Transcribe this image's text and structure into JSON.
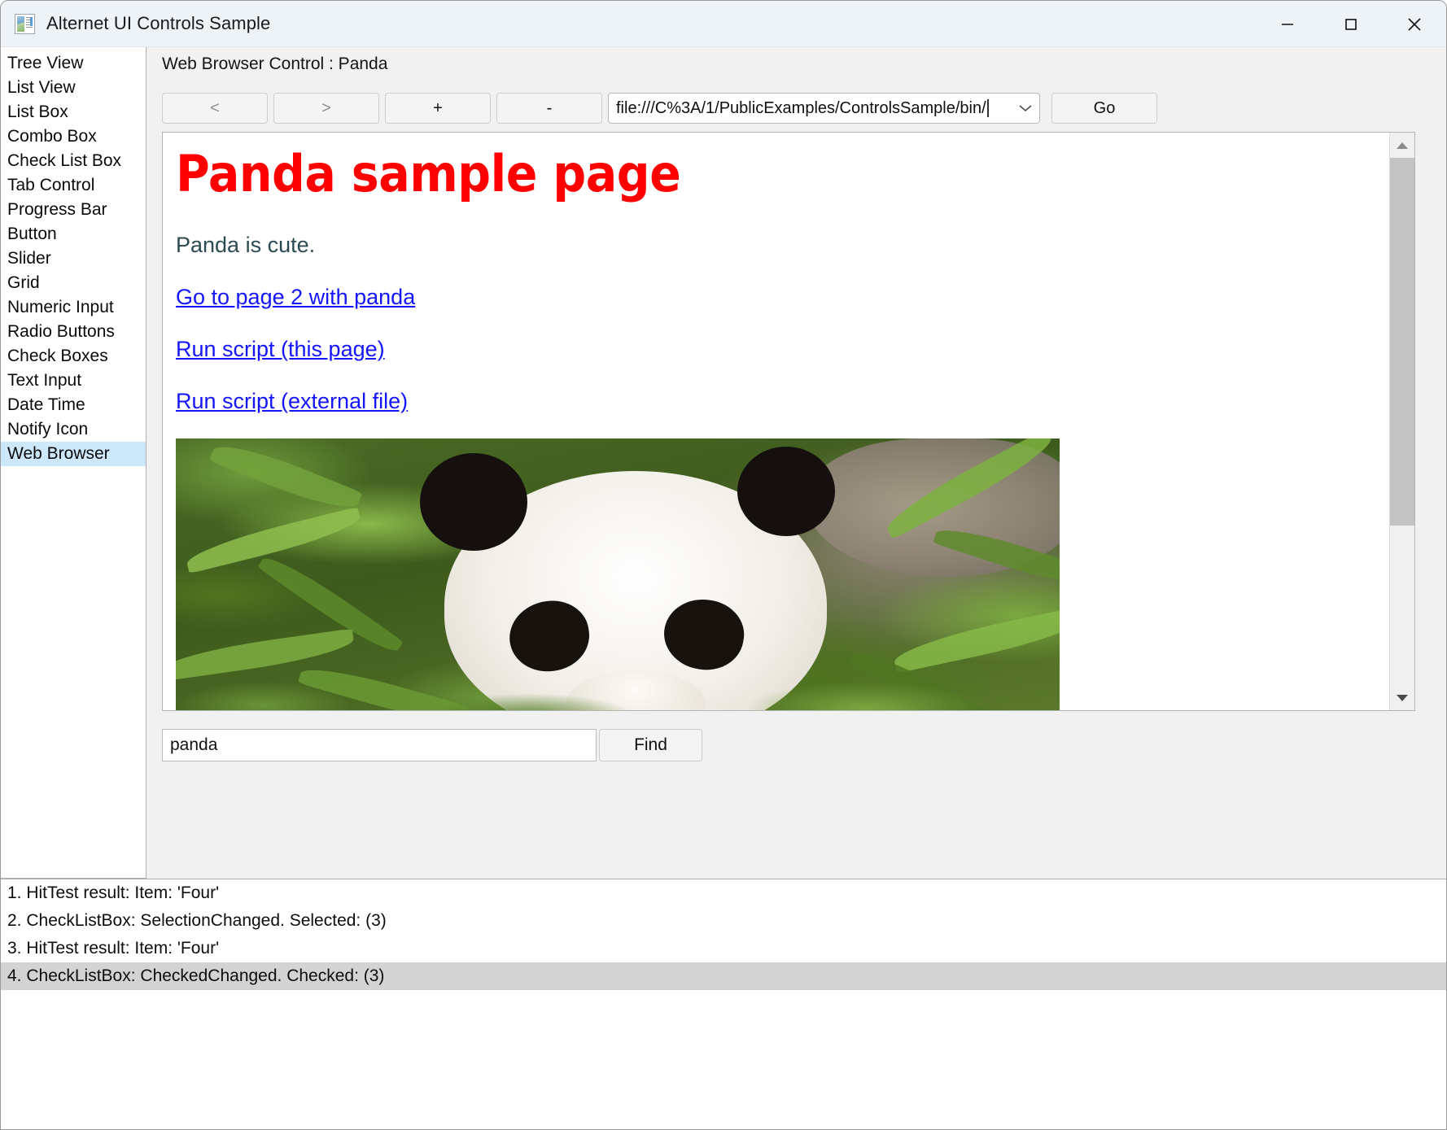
{
  "window": {
    "title": "Alternet UI Controls Sample",
    "app_icon": "app-window-icon",
    "minimize_label": "Minimize",
    "maximize_label": "Maximize",
    "close_label": "Close"
  },
  "sidebar": {
    "items": [
      {
        "label": "Tree View",
        "selected": false
      },
      {
        "label": "List View",
        "selected": false
      },
      {
        "label": "List Box",
        "selected": false
      },
      {
        "label": "Combo Box",
        "selected": false
      },
      {
        "label": "Check List Box",
        "selected": false
      },
      {
        "label": "Tab Control",
        "selected": false
      },
      {
        "label": "Progress Bar",
        "selected": false
      },
      {
        "label": "Button",
        "selected": false
      },
      {
        "label": "Slider",
        "selected": false
      },
      {
        "label": "Grid",
        "selected": false
      },
      {
        "label": "Numeric Input",
        "selected": false
      },
      {
        "label": "Radio Buttons",
        "selected": false
      },
      {
        "label": "Check Boxes",
        "selected": false
      },
      {
        "label": "Text Input",
        "selected": false
      },
      {
        "label": "Date Time",
        "selected": false
      },
      {
        "label": "Notify Icon",
        "selected": false
      },
      {
        "label": "Web Browser",
        "selected": true
      }
    ],
    "selected_color": "#cde8fb"
  },
  "pane": {
    "title": "Web Browser Control : Panda"
  },
  "toolbar": {
    "back_label": "<",
    "forward_label": ">",
    "zoom_in_label": "+",
    "zoom_out_label": "-",
    "go_label": "Go",
    "url_value": "file:///C%3A/1/PublicExamples/ControlsSample/bin/",
    "url_dropdown_icon": "chevron-down-icon"
  },
  "browser": {
    "heading": "Panda sample page",
    "heading_color": "#ff0000",
    "paragraph": "Panda is cute.",
    "links": [
      {
        "label": "Go to page 2 with panda"
      },
      {
        "label": "Run script (this page)"
      },
      {
        "label": "Run script (external file)"
      }
    ],
    "link_color": "#1414ff",
    "image_alt": "panda-photo",
    "scroll_up_icon": "triangle-up-icon",
    "scroll_down_icon": "triangle-down-icon"
  },
  "find": {
    "value": "panda",
    "placeholder": "",
    "button_label": "Find"
  },
  "log": {
    "rows": [
      {
        "text": "1. HitTest result: Item: 'Four'",
        "selected": false
      },
      {
        "text": "2. CheckListBox: SelectionChanged. Selected: (3)",
        "selected": false
      },
      {
        "text": "3. HitTest result: Item: 'Four'",
        "selected": false
      },
      {
        "text": "4. CheckListBox: CheckedChanged. Checked: (3)",
        "selected": true
      }
    ],
    "selected_color": "#d3d3d3"
  }
}
